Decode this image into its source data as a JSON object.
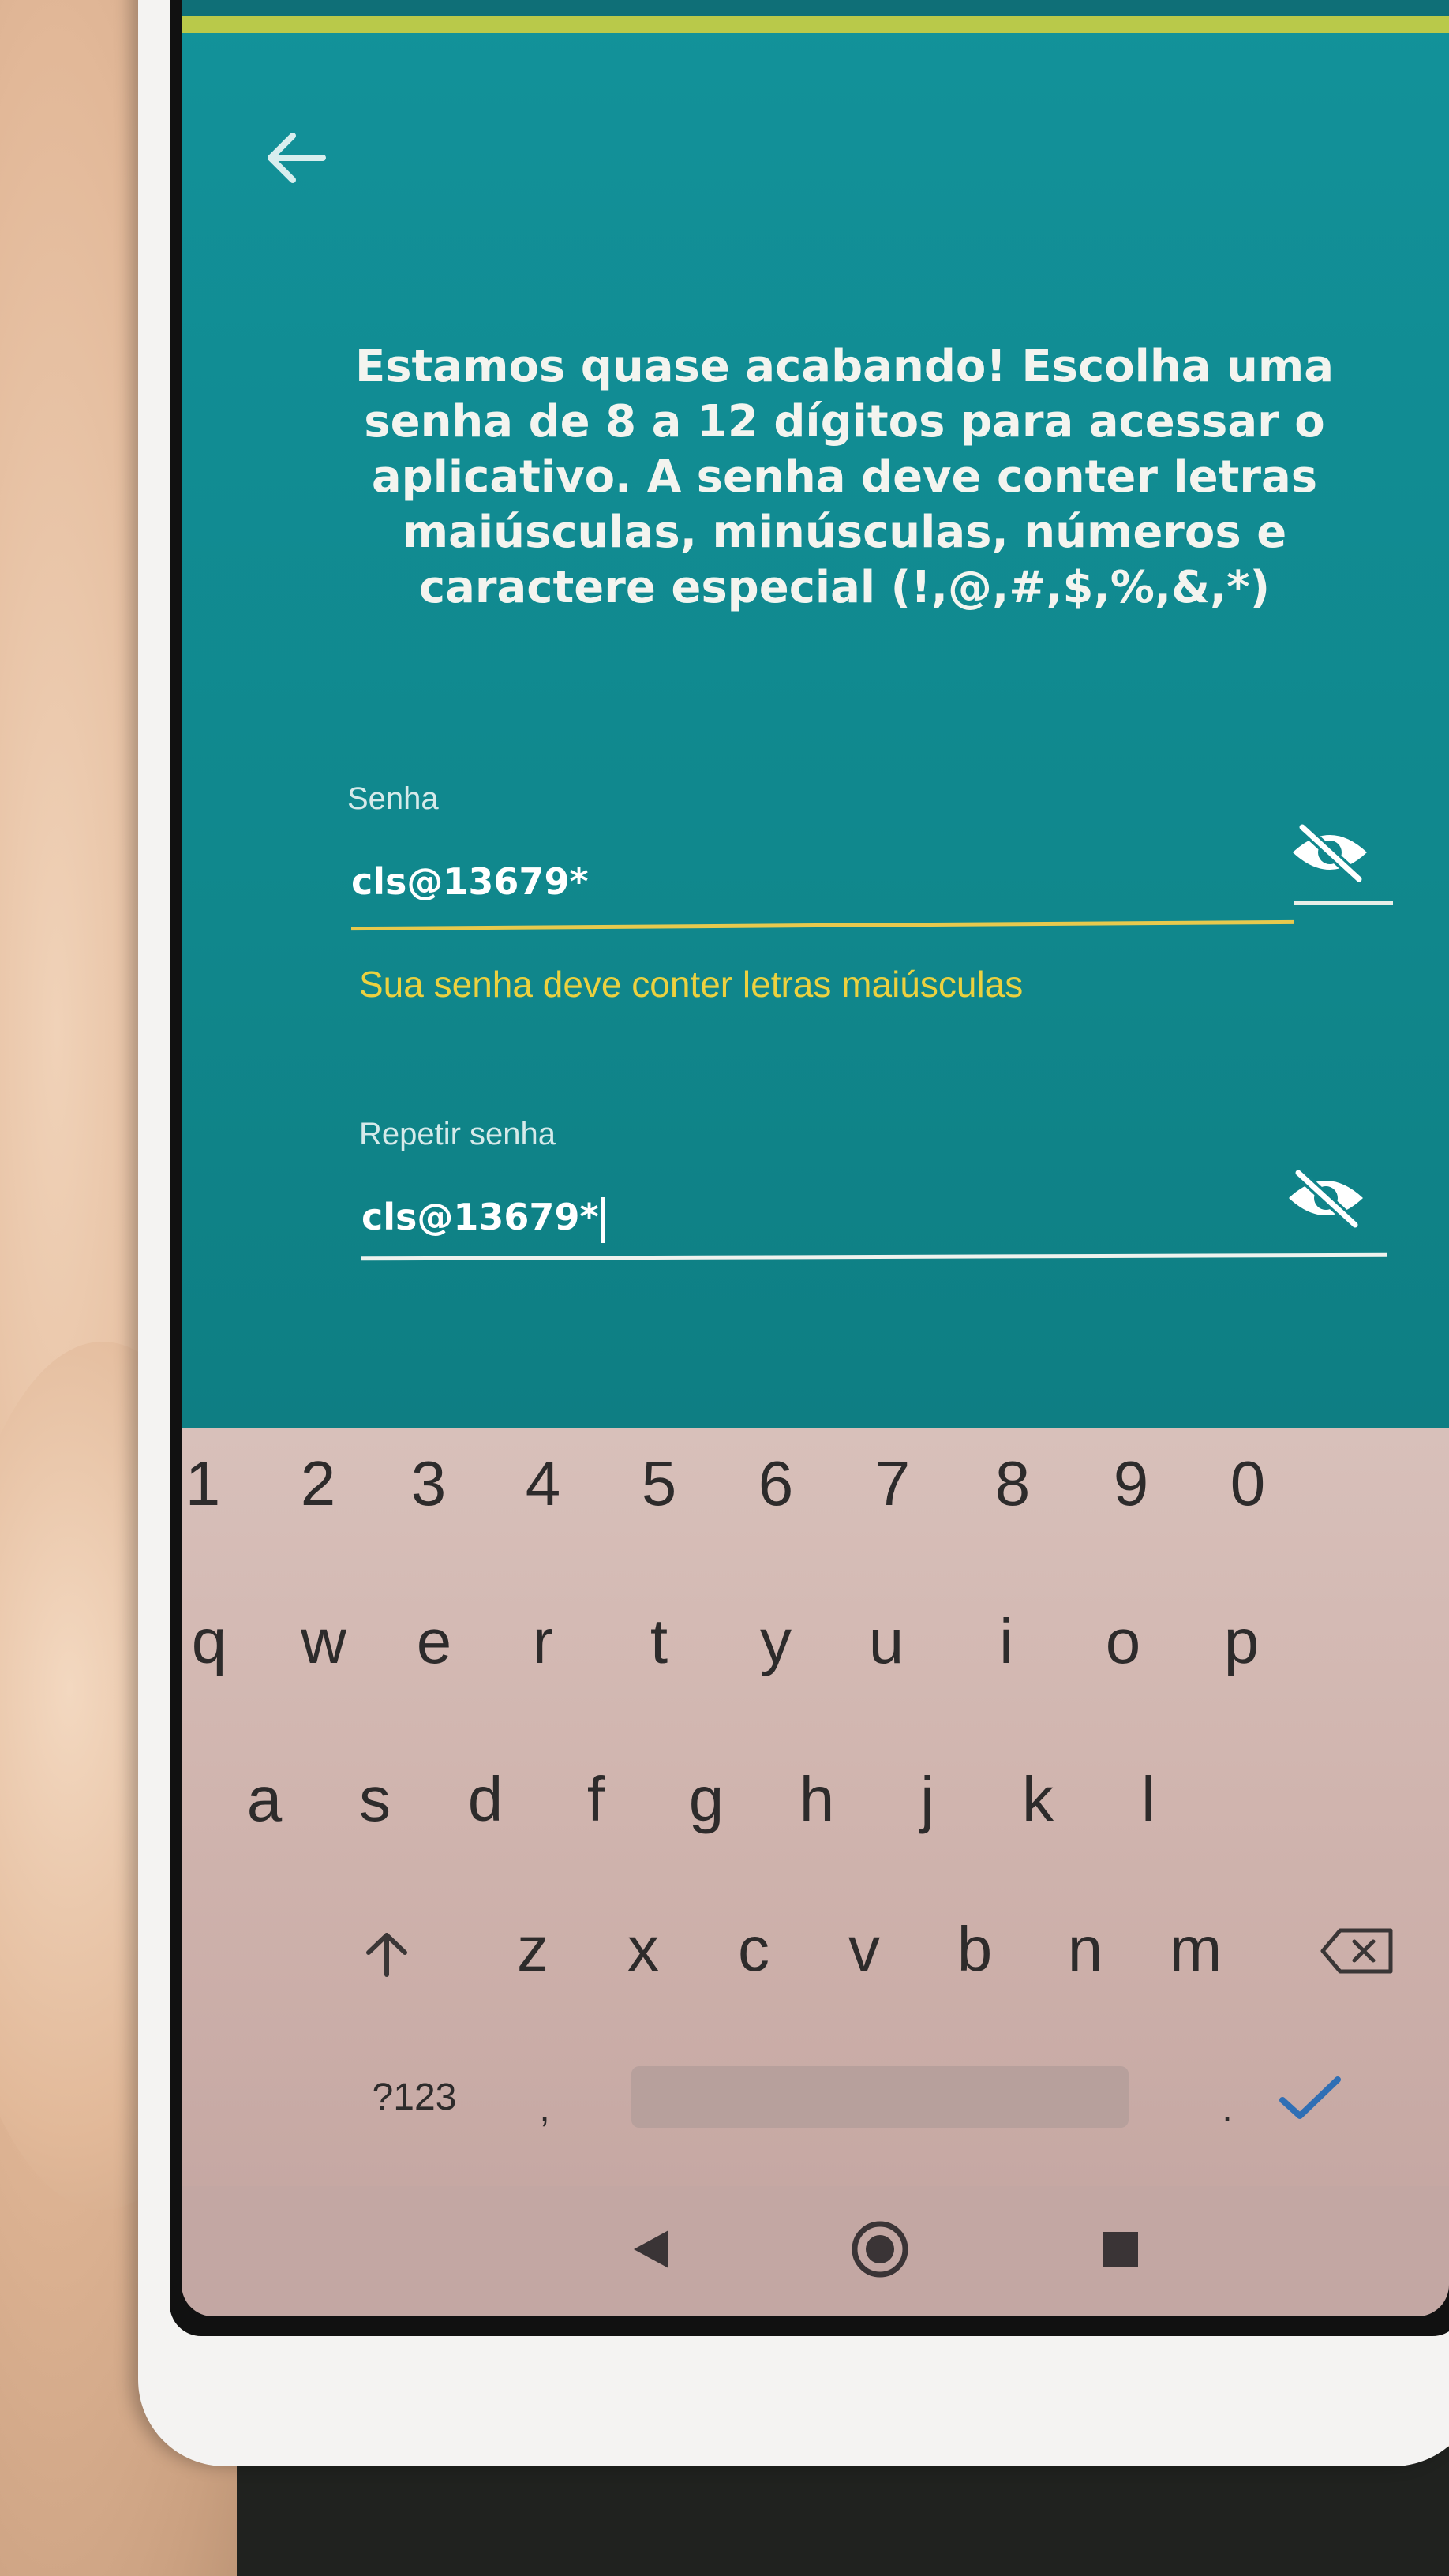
{
  "header": {
    "back_icon": "arrow-left-icon"
  },
  "main": {
    "instructions": "Estamos quase acabando! Escolha uma senha de 8 a 12 dígitos para acessar o aplicativo. A senha deve conter letras maiúsculas, minúsculas, números e caractere especial (!,@,#,$,%,&,*)"
  },
  "form": {
    "password": {
      "label": "Senha",
      "value": "cls@13679*",
      "toggle_icon": "eye-off-icon",
      "error": "Sua senha deve conter letras maiúsculas"
    },
    "confirm": {
      "label": "Repetir senha",
      "value": "cls@13679*",
      "toggle_icon": "eye-off-icon"
    }
  },
  "keyboard": {
    "number_row": [
      "1",
      "2",
      "3",
      "4",
      "5",
      "6",
      "7",
      "8",
      "9",
      "0"
    ],
    "row1": [
      "q",
      "w",
      "e",
      "r",
      "t",
      "y",
      "u",
      "i",
      "o",
      "p"
    ],
    "row2": [
      "a",
      "s",
      "d",
      "f",
      "g",
      "h",
      "j",
      "k",
      "l"
    ],
    "row3": [
      "z",
      "x",
      "c",
      "v",
      "b",
      "n",
      "m"
    ],
    "shift_icon": "shift-arrow-icon",
    "backspace_icon": "backspace-icon",
    "symbols_label": "?123",
    "comma_label": ",",
    "period_label": ".",
    "enter_icon": "checkmark-icon"
  },
  "navbar": {
    "back_icon": "triangle-back-icon",
    "home_icon": "home-circle-icon",
    "recents_icon": "square-recents-icon"
  },
  "colors": {
    "app_background": "#12929a",
    "accent_bar": "#b9c94a",
    "error_text": "#ecd13f",
    "keyboard_background": "#d8c0ba",
    "enter_check": "#2f6fb5"
  }
}
